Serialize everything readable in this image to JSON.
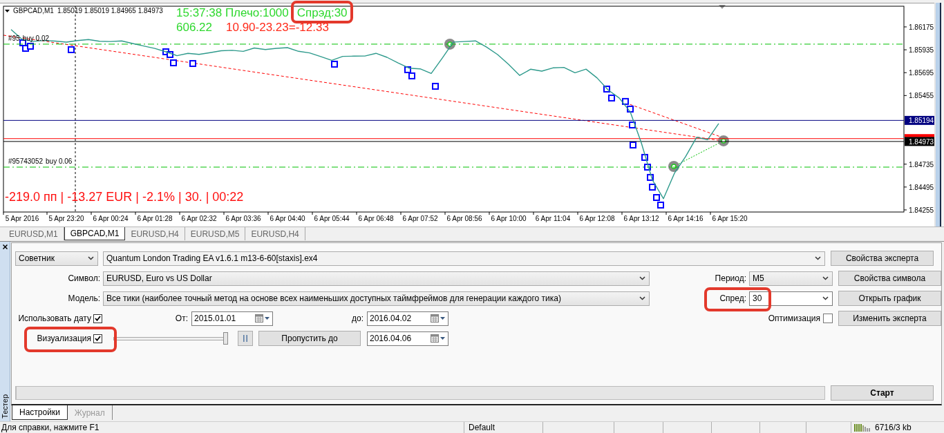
{
  "chart_window": {
    "symbol": "GBPCAD,M1",
    "ohlc": "1.85019 1.85019 1.84965 1.84973",
    "info": {
      "time_leverage": "15:37:38 Плечо:1000",
      "spread": {
        "text": "Спрэд:30",
        "highlighted": true
      },
      "balance": "606.22",
      "profit_calc": "10.90-23.23=-12.33"
    },
    "result_line": "-219.0 пп | -13.27 EUR | -2.1% | 30. | 00:22",
    "order_labels": [
      {
        "ticket": "#95",
        "info": "buy 0.02"
      },
      {
        "ticket": "#95743052",
        "info": "buy 0.06"
      }
    ],
    "chart_data": {
      "type": "line",
      "categories": [
        null,
        null,
        "5 Apr 2016",
        null,
        null,
        null,
        "5 Apr 23:20",
        null,
        null,
        null,
        "6 Apr 00:24",
        null,
        null,
        null,
        "6 Apr 01:28",
        null,
        null,
        null,
        "6 Apr 02:32",
        null,
        null,
        null,
        "6 Apr 03:36",
        null,
        null,
        null,
        "6 Apr 04:40",
        null,
        null,
        null,
        "6 Apr 05:44",
        null,
        null,
        null,
        "6 Apr 06:48",
        null,
        null,
        null,
        "6 Apr 07:52",
        null,
        null,
        null,
        "6 Apr 08:56",
        null,
        null,
        null,
        "6 Apr 10:00",
        null,
        null,
        null,
        "6 Apr 11:04",
        null,
        null,
        null,
        "6 Apr 12:08",
        null,
        null,
        null,
        "6 Apr 13:12",
        null,
        null,
        null,
        "6 Apr 14:16",
        null,
        null,
        null,
        "6 Apr 15:20"
      ],
      "series": [
        {
          "color": "#2e9a8c",
          "values": [
            null,
            1.86148,
            1.86045,
            1.86023,
            1.86033,
            1.86026,
            1.86015,
            1.86032,
            1.86043,
            1.86025,
            1.86022,
            1.86028,
            1.86001,
            1.85975,
            1.85949,
            1.85914,
            1.85873,
            1.85898,
            1.85887,
            1.85905,
            1.85925,
            1.85929,
            1.85918,
            1.85954,
            1.85938,
            1.8595,
            1.85957,
            1.85919,
            1.85902,
            1.85864,
            1.85825,
            1.85866,
            1.85868,
            1.8587,
            1.85898,
            1.85856,
            1.85797,
            1.85742,
            1.85735,
            1.85686,
            1.85847,
            1.86016,
            1.86022,
            1.86028,
            1.85963,
            1.85885,
            1.85781,
            1.85666,
            1.85731,
            1.85711,
            1.85745,
            1.8575,
            1.85694,
            1.85732,
            1.85639,
            1.85513,
            1.85429,
            1.85283,
            1.84959,
            1.8457,
            1.84373,
            1.84641,
            1.84813,
            1.85017,
            1.84992,
            1.85161,
            null
          ]
        }
      ],
      "ylim": [
        1.84233,
        1.86392
      ],
      "yticks": [
        1.86175,
        1.85935,
        1.85695,
        1.85455,
        1.84735,
        1.84495,
        1.84255
      ],
      "ref_lines": [
        {
          "axis": "y",
          "value": 1.85994,
          "color": "#00c000"
        },
        {
          "axis": "y",
          "value": 1.84704,
          "color": "#00c000"
        },
        {
          "axis": "y",
          "value": 1.85194,
          "color": "#000080",
          "label": "1.85194"
        },
        {
          "axis": "y",
          "value": 1.85003,
          "color": "#ff0000"
        },
        {
          "axis": "y",
          "value": 1.84973,
          "color": "#000000",
          "label": "1.84973"
        }
      ]
    }
  },
  "chart_tabs": [
    {
      "label": "EURUSD,M1",
      "selected": false
    },
    {
      "label": "GBPCAD,M1",
      "selected": true
    },
    {
      "label": "EURUSD,H4",
      "selected": false
    },
    {
      "label": "EURUSD,M5",
      "selected": false
    },
    {
      "label": "EURUSD,H4",
      "selected": false
    }
  ],
  "tester": {
    "title": "Тестер",
    "expert_type": "Советник",
    "expert": "Quantum London Trading EA v1.6.1 m13-6-60[staxis].ex4",
    "symbol": {
      "label": "Символ:",
      "value": "EURUSD, Euro vs US Dollar"
    },
    "model": {
      "label": "Модель:",
      "value": "Все тики (наиболее точный метод на основе всех наименьших доступных таймфреймов для генерации каждого тика)"
    },
    "period": {
      "label": "Период:",
      "value": "M5"
    },
    "spread": {
      "label": "Спред:",
      "value": "30",
      "highlighted": true
    },
    "use_date": {
      "label": "Использовать дату",
      "checked": true
    },
    "from": {
      "label": "От:",
      "value": "2015.01.01"
    },
    "to": {
      "label": "до:",
      "value": "2016.04.02"
    },
    "optimization": {
      "label": "Оптимизация",
      "checked": false
    },
    "visualization": {
      "label": "Визуализация",
      "checked": true,
      "highlighted": true
    },
    "speed": {
      "level": 1
    },
    "skip_to": {
      "label": "Пропустить до",
      "value": "2016.04.06"
    },
    "progress": {
      "level": 0
    },
    "side_buttons": [
      "Свойства эксперта",
      "Свойства символа",
      "Открыть график",
      "Изменить эксперта"
    ],
    "start_button": "Старт",
    "tabs": [
      {
        "label": "Настройки",
        "selected": true
      },
      {
        "label": "Журнал",
        "selected": false
      }
    ]
  },
  "status_bar": {
    "help": "Для справки, нажмите F1",
    "profile": "Default",
    "traffic": "6716/3 kb"
  }
}
